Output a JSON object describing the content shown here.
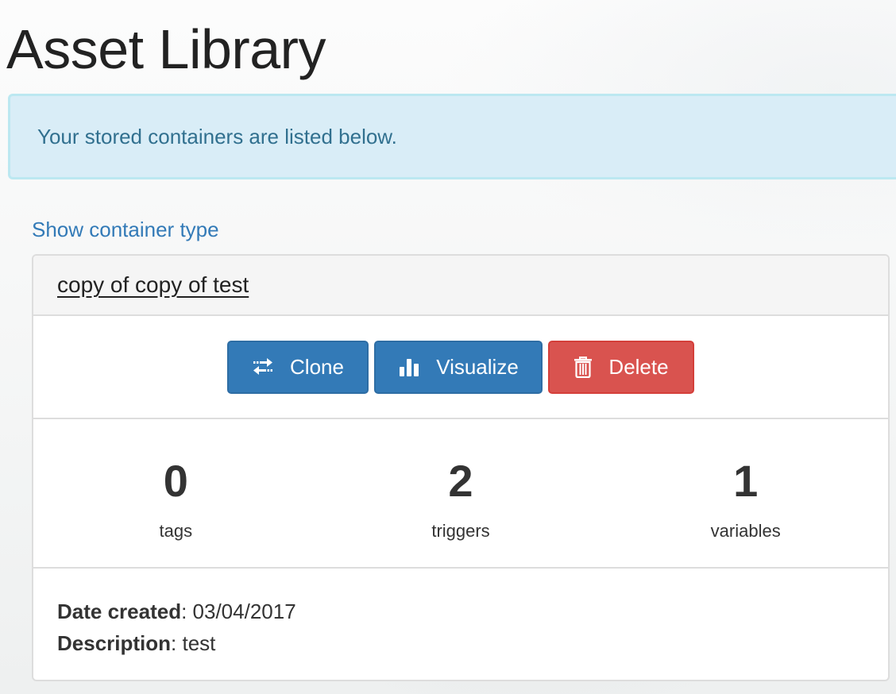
{
  "page": {
    "title": "Asset Library",
    "alert_text": "Your stored containers are listed below.",
    "show_type_link": "Show container type"
  },
  "container": {
    "name": "copy of copy of test",
    "actions": {
      "clone_label": "Clone",
      "visualize_label": "Visualize",
      "delete_label": "Delete"
    },
    "stats": [
      {
        "value": "0",
        "label": "tags"
      },
      {
        "value": "2",
        "label": "triggers"
      },
      {
        "value": "1",
        "label": "variables"
      }
    ],
    "details": {
      "date_label": "Date created",
      "date_value": "03/04/2017",
      "description_label": "Description",
      "description_value": "test"
    }
  },
  "colors": {
    "primary": "#337ab7",
    "danger": "#d9534f",
    "alert_bg": "#d9edf7",
    "alert_text": "#31708f",
    "link": "#337ab7"
  },
  "icons": {
    "clone": "exchange-arrows-icon",
    "visualize": "bar-chart-icon",
    "delete": "trash-icon"
  }
}
